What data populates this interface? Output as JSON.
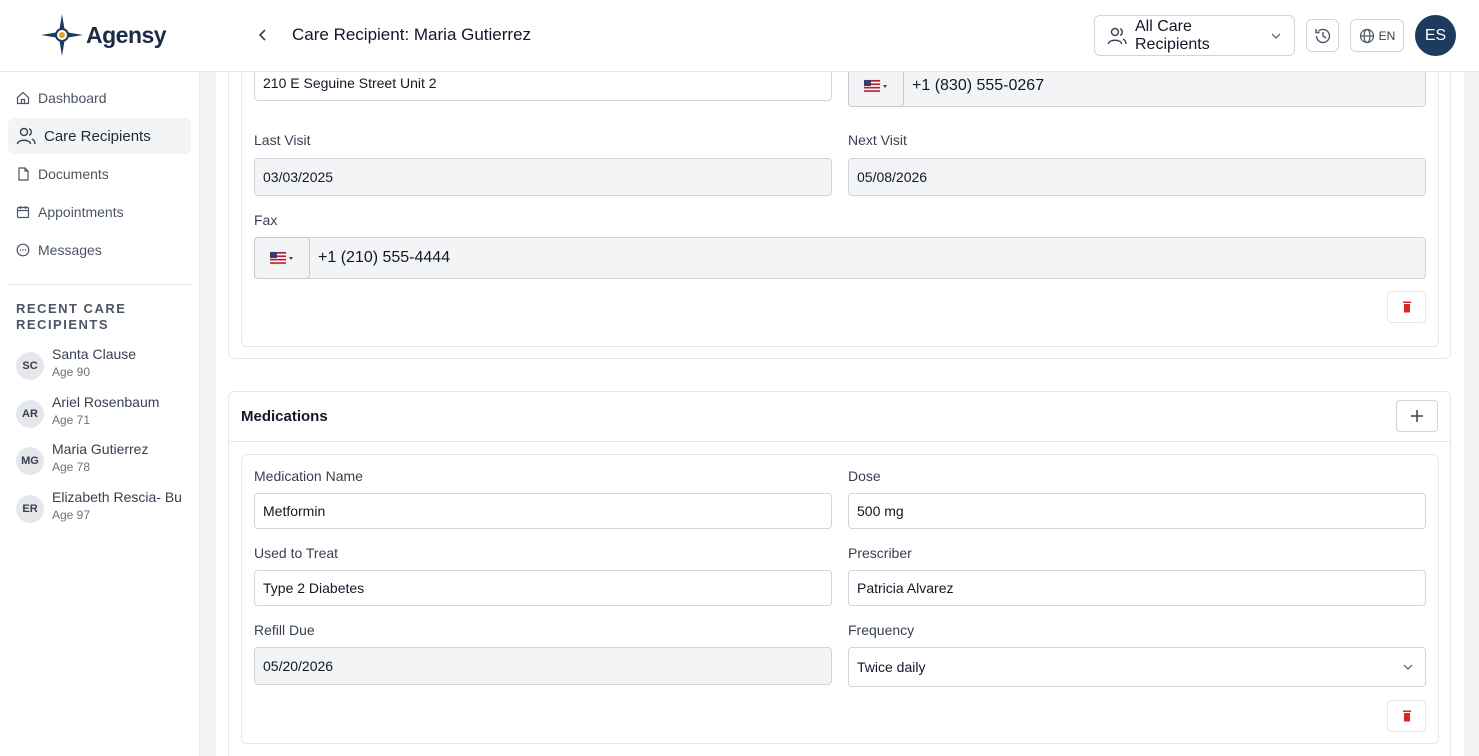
{
  "app": {
    "logo_text": "Agensy"
  },
  "header": {
    "title": "Care Recipient: Maria Gutierrez",
    "recipient_selector": "All Care Recipients",
    "language": "EN",
    "user_initials": "ES"
  },
  "sidebar": {
    "nav": [
      {
        "label": "Dashboard",
        "icon": "home-icon"
      },
      {
        "label": "Care Recipients",
        "icon": "users-icon",
        "active": true
      },
      {
        "label": "Documents",
        "icon": "document-icon"
      },
      {
        "label": "Appointments",
        "icon": "calendar-icon"
      },
      {
        "label": "Messages",
        "icon": "chat-icon"
      }
    ],
    "recent_title": "Recent Care Recipients",
    "recent": [
      {
        "initials": "SC",
        "name": "Santa Clause",
        "age": "Age 90"
      },
      {
        "initials": "AR",
        "name": "Ariel Rosenbaum",
        "age": "Age 71"
      },
      {
        "initials": "MG",
        "name": "Maria Gutierrez",
        "age": "Age 78"
      },
      {
        "initials": "ER",
        "name": "Elizabeth Rescia- Bu",
        "age": "Age 97"
      }
    ]
  },
  "provider_card": {
    "address_value": "210 E Seguine Street Unit 2",
    "phone_value": "+1 (830) 555-0267",
    "last_visit_label": "Last Visit",
    "last_visit_value": "03/03/2025",
    "next_visit_label": "Next Visit",
    "next_visit_value": "05/08/2026",
    "fax_label": "Fax",
    "fax_value": "+1 (210) 555-4444"
  },
  "medications": {
    "title": "Medications",
    "name_label": "Medication Name",
    "name_value": "Metformin",
    "dose_label": "Dose",
    "dose_value": "500 mg",
    "treat_label": "Used to Treat",
    "treat_value": "Type 2 Diabetes",
    "prescriber_label": "Prescriber",
    "prescriber_value": "Patricia Alvarez",
    "refill_label": "Refill Due",
    "refill_value": "05/20/2026",
    "frequency_label": "Frequency",
    "frequency_value": "Twice daily"
  },
  "colors": {
    "brand": "#1e3a5f",
    "delete": "#dc2626"
  }
}
